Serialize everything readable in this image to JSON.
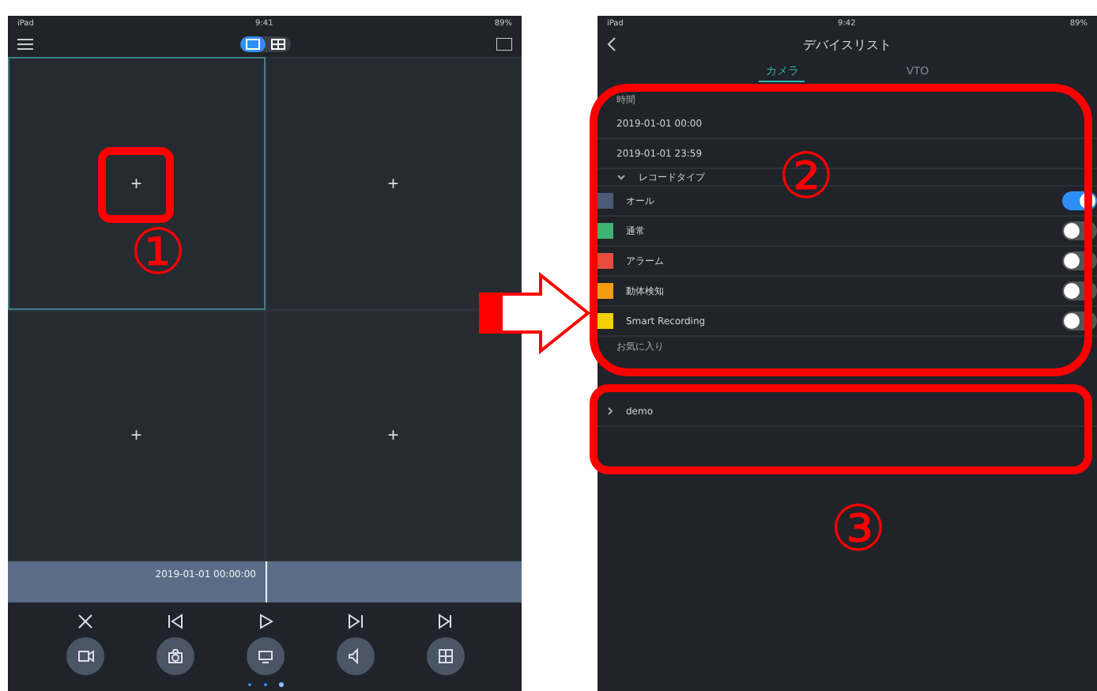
{
  "left_screen": {
    "status_bar": {
      "carrier": "iPad",
      "time": "9:41",
      "battery": "89%"
    },
    "layout_switch": [
      {
        "kind": "single",
        "selected": true
      },
      {
        "kind": "quad",
        "selected": false
      }
    ],
    "cells": [
      {
        "selected": true,
        "symbol": "+"
      },
      {
        "selected": false,
        "symbol": "+"
      },
      {
        "selected": false,
        "symbol": "+"
      },
      {
        "selected": false,
        "symbol": "+"
      }
    ],
    "timeline": {
      "time": "2019-01-01  00:00:00"
    },
    "controls": [
      {
        "kind": "cut"
      },
      {
        "kind": "step-back"
      },
      {
        "kind": "play"
      },
      {
        "kind": "step-forward"
      },
      {
        "kind": "end"
      }
    ],
    "buttons": [
      {
        "kind": "video"
      },
      {
        "kind": "camera"
      },
      {
        "kind": "stream"
      },
      {
        "kind": "speaker"
      },
      {
        "kind": "grid"
      }
    ]
  },
  "right_screen": {
    "status_bar": {
      "carrier": "iPad",
      "time": "9:42",
      "battery": "89%"
    },
    "title": "デバイスリスト",
    "tabs": [
      {
        "label": "カメラ",
        "selected": true
      },
      {
        "label": "VTO",
        "selected": false
      }
    ],
    "time_section": {
      "label": "時間",
      "start": "2019-01-01 00:00",
      "end": "2019-01-01 23:59"
    },
    "record_type": {
      "label": "レコードタイプ",
      "expanded": true
    },
    "record_types": [
      {
        "label": "オール",
        "color": "#4a5a78",
        "on": true
      },
      {
        "label": "通常",
        "color": "#3cb371",
        "on": false
      },
      {
        "label": "アラーム",
        "color": "#e74c3c",
        "on": false
      },
      {
        "label": "動体検知",
        "color": "#f39c12",
        "on": false
      },
      {
        "label": "Smart Recording",
        "color": "#f5d000",
        "on": false
      }
    ],
    "favorites": {
      "label": "お気に入り"
    },
    "devices": [
      {
        "label": "demo"
      }
    ]
  },
  "annotations": [
    {
      "number": "①"
    },
    {
      "number": "②"
    },
    {
      "number": "③"
    }
  ]
}
